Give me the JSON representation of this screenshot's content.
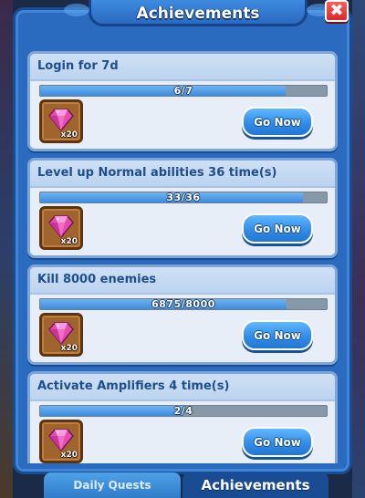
{
  "panel": {
    "title": "Achievements",
    "close_icon": "close-x-icon"
  },
  "achievements": [
    {
      "title": "Login for 7d",
      "progress_text": "6/7",
      "progress": 0.857,
      "reward_icon": "pink-gem-icon",
      "reward_count": "x20",
      "button_label": "Go Now"
    },
    {
      "title": "Level up Normal abilities 36 time(s)",
      "progress_text": "33/36",
      "progress": 0.917,
      "reward_icon": "pink-gem-icon",
      "reward_count": "x20",
      "button_label": "Go Now"
    },
    {
      "title": "Kill 8000 enemies",
      "progress_text": "6875/8000",
      "progress": 0.859,
      "reward_icon": "pink-gem-icon",
      "reward_count": "x20",
      "button_label": "Go Now"
    },
    {
      "title": "Activate Amplifiers 4 time(s)",
      "progress_text": "2/4",
      "progress": 0.5,
      "reward_icon": "pink-gem-icon",
      "reward_count": "x20",
      "button_label": "Go Now"
    }
  ],
  "tabs": [
    {
      "label": "Daily Quests",
      "active": false
    },
    {
      "label": "Achievements",
      "active": true
    }
  ],
  "colors": {
    "panel_blue": "#2a6bc0",
    "button_blue": "#2f8ae6",
    "close_red": "#d92a2a",
    "reward_brown": "#a0652c",
    "gem_pink": "#e64cb0"
  }
}
